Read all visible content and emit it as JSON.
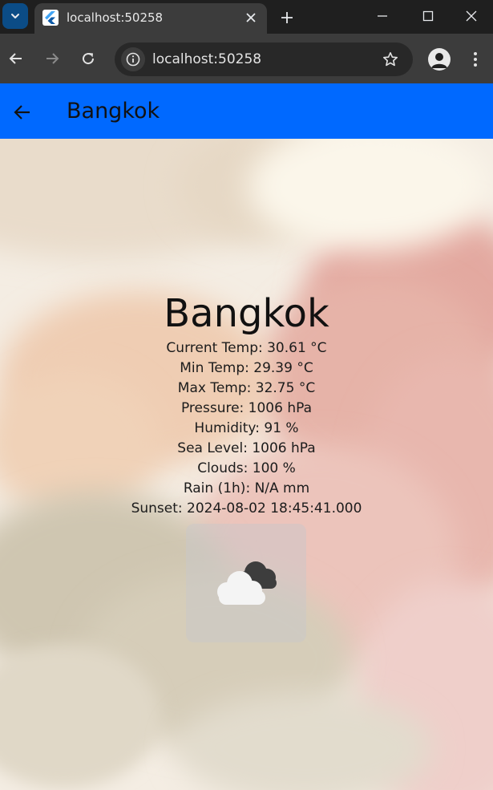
{
  "browser": {
    "tab_title": "localhost:50258",
    "url": "localhost:50258",
    "icons": {
      "tab_search": "chevron-down-icon",
      "favicon": "flutter-icon",
      "close": "close-icon",
      "new_tab": "plus-icon",
      "minimize": "minimize-icon",
      "maximize": "maximize-icon",
      "window_close": "window-close-icon",
      "back": "arrow-left-icon",
      "forward": "arrow-right-icon",
      "reload": "reload-icon",
      "site_info": "info-icon",
      "bookmark": "star-icon",
      "profile": "person-icon",
      "menu": "kebab-icon"
    }
  },
  "appbar": {
    "title": "Bangkok",
    "color": "#0069ff"
  },
  "weather": {
    "city": "Bangkok",
    "details": [
      "Current Temp: 30.61 °C",
      "Min Temp: 29.39 °C",
      "Max Temp: 32.75 °C",
      "Pressure: 1006 hPa",
      "Humidity: 91 %",
      "Sea Level: 1006 hPa",
      "Clouds: 100 %",
      "Rain (1h): N/A mm",
      "Sunset: 2024-08-02 18:45:41.000"
    ],
    "icon": "overcast-clouds-icon"
  }
}
